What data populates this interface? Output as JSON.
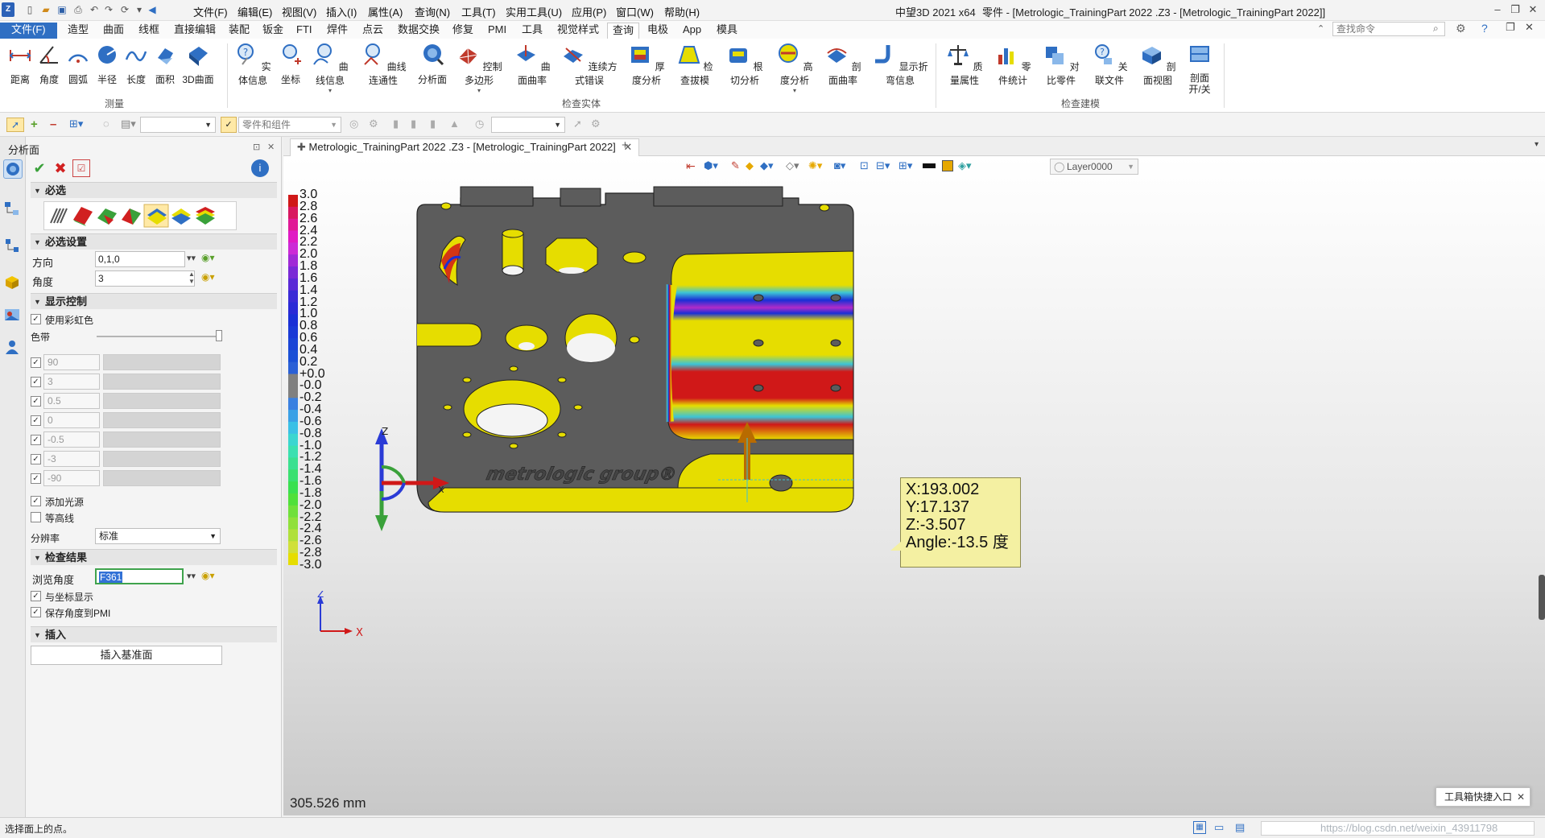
{
  "app": {
    "menus": [
      "文件(F)",
      "编辑(E)",
      "视图(V)",
      "插入(I)",
      "属性(A)",
      "查询(N)",
      "工具(T)",
      "实用工具(U)",
      "应用(P)",
      "窗口(W)",
      "帮助(H)"
    ],
    "product": "中望3D 2021 x64",
    "window_title": "零件 - [Metrologic_TrainingPart  2022 .Z3 - [Metrologic_TrainingPart  2022]]"
  },
  "ribbon_tabs": [
    "文件(F)",
    "造型",
    "曲面",
    "线框",
    "直接编辑",
    "装配",
    "钣金",
    "FTI",
    "焊件",
    "点云",
    "数据交换",
    "修复",
    "PMI",
    "工具",
    "视觉样式",
    "查询",
    "电极",
    "App",
    "模具"
  ],
  "active_tab": "查询",
  "search_placeholder": "查找命令",
  "ribbon": {
    "measure": {
      "group": "测量",
      "buttons": [
        "距离",
        "角度",
        "圆弧",
        "半径",
        "长度",
        "面积",
        "3D曲面"
      ]
    },
    "inspect_entity": {
      "group": "检查实体",
      "buttons": [
        "实体信息",
        "坐标",
        "曲线信息",
        "曲线连通性",
        "分析面",
        "控制多边形",
        "曲面曲率",
        "连续方式错误",
        "厚度分析",
        "检查拔模",
        "根切分析",
        "高度分析",
        "剖面曲率",
        "显示折弯信息"
      ]
    },
    "inspect_model": {
      "group": "检查建模",
      "buttons": [
        "质量属性",
        "零件统计",
        "对比零件",
        "关联文件",
        "剖面视图",
        "剖面 开/关"
      ]
    }
  },
  "toolrow": {
    "filter_value": "零件和组件"
  },
  "panel": {
    "title": "分析面",
    "sections": {
      "required": "必选",
      "required_settings": "必选设置",
      "display_control": "显示控制",
      "inspect_results": "检查结果",
      "insert": "插入"
    },
    "direction_label": "方向",
    "direction_value": "0,1,0",
    "angle_label": "角度",
    "angle_value": "3",
    "use_rainbow": "使用彩虹色",
    "color_band": "色带",
    "band_values": [
      "90",
      "3",
      "0.5",
      "0",
      "-0.5",
      "-3",
      "-90"
    ],
    "add_light": "添加光源",
    "contour": "等高线",
    "resolution_label": "分辨率",
    "resolution_value": "标准",
    "browse_angle_label": "浏览角度",
    "browse_angle_value": "F361",
    "show_with_coords": "与坐标显示",
    "save_angle_pmi": "保存角度到PMI",
    "insert_datum": "插入基准面"
  },
  "document_tab": "Metrologic_TrainingPart  2022 .Z3 - [Metrologic_TrainingPart  2022]",
  "layer": "Layer0000",
  "legend": {
    "ticks": [
      "3.0",
      "2.8",
      "2.6",
      "2.4",
      "2.2",
      "2.0",
      "1.8",
      "1.6",
      "1.4",
      "1.2",
      "1.0",
      "0.8",
      "0.6",
      "0.4",
      "0.2",
      "+0.0",
      "-0.0",
      "-0.2",
      "-0.4",
      "-0.6",
      "-0.8",
      "-1.0",
      "-1.2",
      "-1.4",
      "-1.6",
      "-1.8",
      "-2.0",
      "-2.2",
      "-2.4",
      "-2.6",
      "-2.8",
      "-3.0"
    ]
  },
  "part_logo": "metrologic group®",
  "tooltip": {
    "x": "X:193.002",
    "y": "Y:17.137",
    "z": "Z:-3.507",
    "angle": "Angle:-13.5 度"
  },
  "triad": {
    "x": "X",
    "z": "Z"
  },
  "scale_text": "305.526 mm",
  "quick_entry": "工具箱快捷入口",
  "status_text": "选择面上的点。",
  "watermark": "https://blog.csdn.net/weixin_43911798",
  "colors": {
    "part_gray": "#5c5c5c",
    "yellow": "#e6dd00",
    "file_tab": "#2f6fc3"
  }
}
